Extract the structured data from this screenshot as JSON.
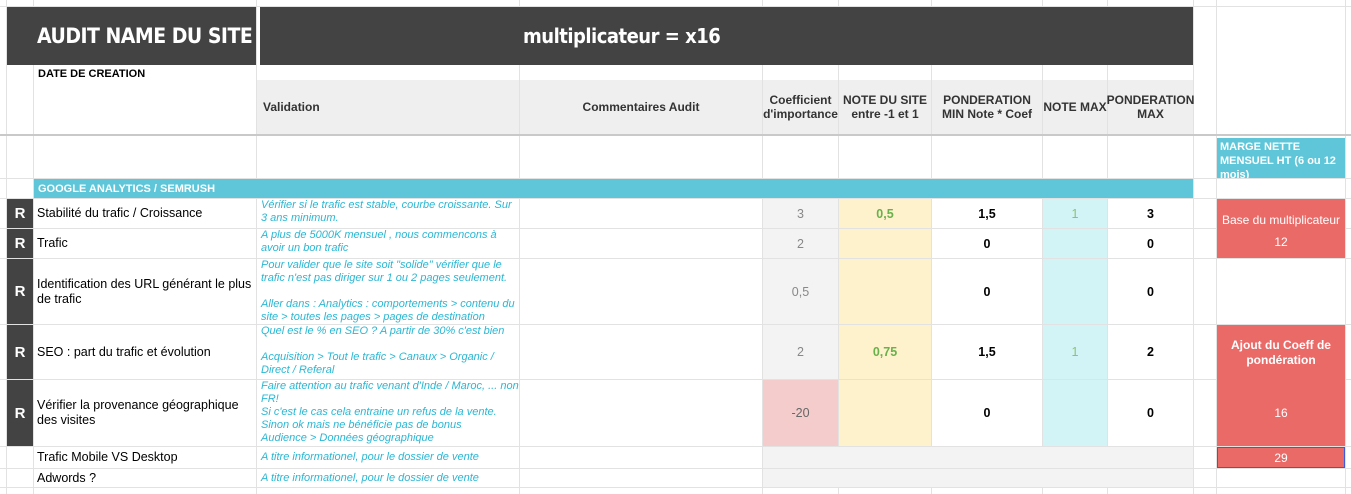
{
  "header": {
    "audit_title": "AUDIT NAME DU SITE",
    "multiplier": "multiplicateur = x16",
    "creation_date_label": "DATE DE CREATION"
  },
  "columns": {
    "validation": "Validation",
    "comments": "Commentaires Audit",
    "coef": "Coefficient d'importance",
    "note_site": "NOTE DU SITE entre -1 et 1",
    "pond_min": "PONDERATION MIN Note * Coef",
    "note_max": "NOTE MAX",
    "pond_max": "PONDERATION MAX"
  },
  "section": {
    "title": "GOOGLE ANALYTICS / SEMRUSH"
  },
  "side": {
    "marge_label": "MARGE NETTE MENSUEL HT (6 ou 12 mois)",
    "base_label": "Base du multiplicateur",
    "base_value": "12",
    "ajout_label": "Ajout du Coeff de pondération",
    "ajout_value": "16",
    "total_value": "29"
  },
  "rows": [
    {
      "marker": "R",
      "label": "Stabilité du trafic / Croissance",
      "validation": "Vérifier si le trafic est stable, courbe croissante. Sur 3 ans minimum.",
      "coef": "3",
      "note_site": "0,5",
      "pond_min": "1,5",
      "note_max": "1",
      "pond_max": "3"
    },
    {
      "marker": "R",
      "label": "Trafic",
      "validation": "A plus de 5000K mensuel , nous commencons à avoir un bon trafic",
      "coef": "2",
      "note_site": "",
      "pond_min": "0",
      "note_max": "",
      "pond_max": "0"
    },
    {
      "marker": "R",
      "label": "Identification des URL générant le plus de trafic",
      "validation": "Pour valider que le site soit \"solide\" vérifier que le trafic n'est pas diriger sur 1 ou 2 pages seulement.",
      "validation2": "Aller dans : Analytics : comportements > contenu du site > toutes les pages > pages de destination",
      "coef": "0,5",
      "note_site": "",
      "pond_min": "0",
      "note_max": "",
      "pond_max": "0"
    },
    {
      "marker": "R",
      "label": "SEO : part du trafic et évolution",
      "validation": "Quel est le % en SEO ? A partir de 30% c'est bien",
      "validation2": "Acquisition > Tout le trafic > Canaux > Organic / Direct / Referal",
      "coef": "2",
      "note_site": "0,75",
      "pond_min": "1,5",
      "note_max": "1",
      "pond_max": "2"
    },
    {
      "marker": "R",
      "label": "Vérifier la provenance géographique des visites",
      "validation": "Faire attention au trafic venant d'Inde / Maroc, ... non FR!",
      "validation2": "Si c'est le cas cela entraine un refus de la vente. Sinon ok mais ne bénéficie pas de bonus",
      "validation3": "Audience > Données géographique",
      "coef": "-20",
      "note_site": "",
      "pond_min": "0",
      "note_max": "",
      "pond_max": "0"
    },
    {
      "marker": "",
      "label": "Trafic Mobile VS Desktop",
      "validation": "A titre informationel, pour le dossier de vente"
    },
    {
      "marker": "",
      "label": "Adwords ?",
      "validation": "A titre informationel, pour le dossier de vente"
    }
  ]
}
